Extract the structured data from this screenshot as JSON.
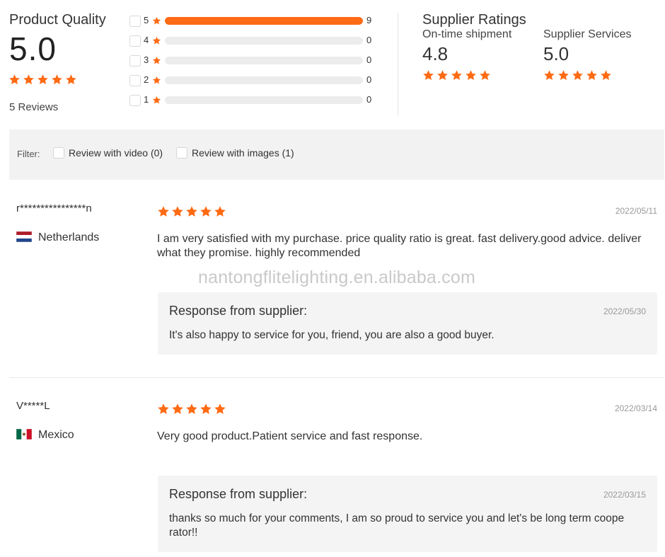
{
  "product_quality": {
    "title": "Product Quality",
    "score": "5.0",
    "star_rating": 5,
    "reviews_label": "5 Reviews"
  },
  "distribution": [
    {
      "level": "5",
      "count": "9",
      "fill_fraction": 1.0
    },
    {
      "level": "4",
      "count": "0",
      "fill_fraction": 0
    },
    {
      "level": "3",
      "count": "0",
      "fill_fraction": 0
    },
    {
      "level": "2",
      "count": "0",
      "fill_fraction": 0
    },
    {
      "level": "1",
      "count": "0",
      "fill_fraction": 0
    }
  ],
  "supplier_ratings": {
    "title": "Supplier Ratings",
    "shipment_label": "On-time shipment",
    "shipment_score": "4.8",
    "shipment_stars": 5,
    "services_label": "Supplier Services",
    "services_score": "5.0",
    "services_stars": 5
  },
  "filter": {
    "label": "Filter:",
    "video_label": "Review with video (0)",
    "images_label": "Review with images (1)"
  },
  "reviews": [
    {
      "reviewer": "r****************n",
      "country": "Netherlands",
      "flag": "netherlands-flag",
      "stars": 5,
      "date": "2022/05/11",
      "text": "I am very satisfied with my purchase. price quality ratio is great. fast delivery.good advice. deliver what they promise. highly recommended",
      "response_title": "Response from supplier:",
      "response_date": "2022/05/30",
      "response_text": "It's also happy to service for you, friend, you are also a good buyer."
    },
    {
      "reviewer": "V*****L",
      "country": "Mexico",
      "flag": "mexico-flag",
      "stars": 5,
      "date": "2022/03/14",
      "text": "Very good product.Patient service and fast response.",
      "response_title": "Response from supplier:",
      "response_date": "2022/03/15",
      "response_text": "thanks so much for your comments, I am so proud to service you and let's be long term coope rator!!"
    }
  ],
  "watermark": "nantongflitelighting.en.alibaba.com",
  "colors": {
    "accent": "#ff6a14",
    "track": "#ececec",
    "filter_bg": "#f2f2f2",
    "response_bg": "#f4f4f4"
  }
}
